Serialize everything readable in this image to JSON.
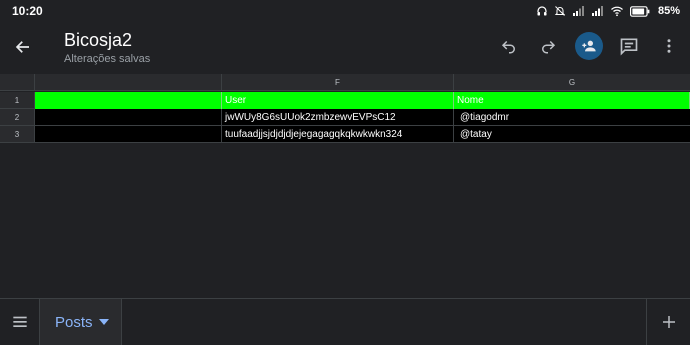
{
  "status_bar": {
    "time": "10:20",
    "battery": "85%",
    "icons": [
      "headphones-icon",
      "bell-off-icon",
      "signal-icon",
      "signal-icon",
      "wifi-icon",
      "battery-icon"
    ]
  },
  "appbar": {
    "title": "Bicosja2",
    "subtitle": "Alterações salvas",
    "actions": [
      "back-icon",
      "undo-icon",
      "redo-icon",
      "person-add-icon",
      "comment-icon",
      "more-vert-icon"
    ],
    "share_color": "#1a5a8a"
  },
  "grid": {
    "columns": [
      "",
      "F",
      "G"
    ],
    "row_numbers": [
      "1",
      "2",
      "3"
    ],
    "rows": [
      {
        "e": "",
        "f": "User",
        "g": "Nome",
        "bg": "#00ff00"
      },
      {
        "e": "",
        "f": "jwWUy8G6sUUok2zmbzewvEVPsC12",
        "g": "@tiagodmr",
        "bg": "#000000"
      },
      {
        "e": "",
        "f": "tuufaadjjsjdjdjdjejegagagqkqkwkwkn324",
        "g": "@tatay",
        "bg": "#000000"
      }
    ]
  },
  "bottom_bar": {
    "sheet_tab": "Posts",
    "tab_color": "#8ab4f8"
  }
}
